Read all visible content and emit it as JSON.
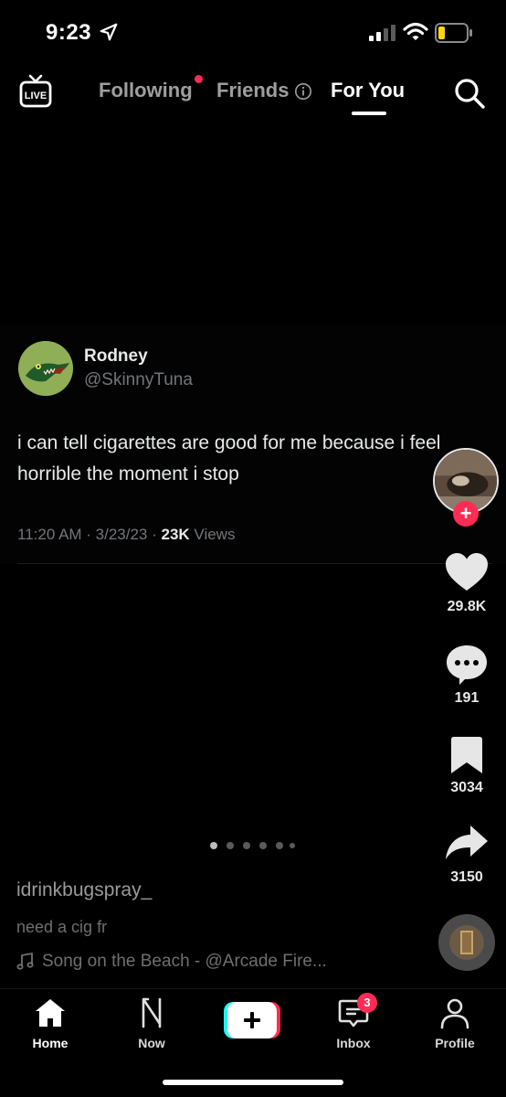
{
  "status_bar": {
    "time": "9:23"
  },
  "top_nav": {
    "tabs": [
      "Following",
      "Friends",
      "For You"
    ],
    "active_tab": "For You",
    "live_label": "LIVE"
  },
  "tweet": {
    "name": "Rodney",
    "handle": "@SkinnyTuna",
    "text": "i can tell cigarettes are good for me because i feel horrible the moment i stop",
    "timestamp": "11:20 AM · 3/23/23 · ",
    "views_count": "23K",
    "views_label": " Views"
  },
  "actions": {
    "likes": "29.8K",
    "comments": "191",
    "bookmarks": "3034",
    "shares": "3150"
  },
  "post": {
    "username": "idrinkbugspray_",
    "caption": "need a cig fr",
    "song": "Song on the Beach - @Arcade Fire..."
  },
  "bottom_nav": {
    "home": "Home",
    "now": "Now",
    "inbox": "Inbox",
    "inbox_badge": "3",
    "profile": "Profile"
  },
  "colors": {
    "accent": "#fe2c55",
    "background": "#000000",
    "tweet_muted": "#71767b"
  },
  "icons": [
    "location-arrow-icon",
    "signal-icon",
    "wifi-icon",
    "battery-icon",
    "live-tv-icon",
    "info-icon",
    "search-icon",
    "heart-icon",
    "comment-icon",
    "bookmark-icon",
    "share-icon",
    "music-note-icon",
    "home-icon",
    "now-icon",
    "create-plus-icon",
    "inbox-icon",
    "profile-icon"
  ]
}
